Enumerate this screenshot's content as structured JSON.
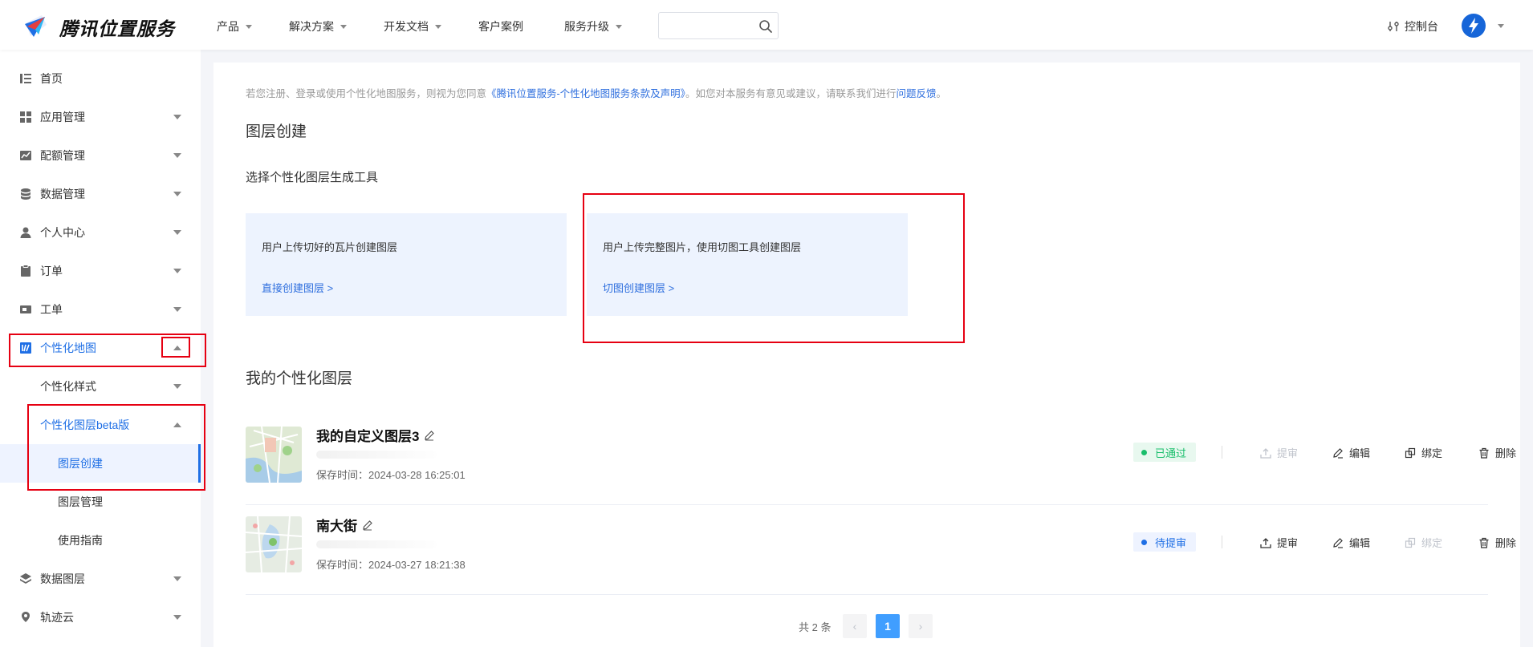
{
  "brand": {
    "name": "腾讯位置服务"
  },
  "topnav": {
    "items": [
      "产品",
      "解决方案",
      "开发文档",
      "客户案例",
      "服务升级"
    ],
    "search_placeholder": "",
    "console_label": "控制台"
  },
  "sidebar": {
    "items": [
      {
        "label": "首页",
        "icon": "list-icon"
      },
      {
        "label": "应用管理",
        "icon": "grid-icon"
      },
      {
        "label": "配额管理",
        "icon": "chart-icon"
      },
      {
        "label": "数据管理",
        "icon": "database-icon"
      },
      {
        "label": "个人中心",
        "icon": "user-icon"
      },
      {
        "label": "订单",
        "icon": "clipboard-icon"
      },
      {
        "label": "工单",
        "icon": "ticket-icon"
      },
      {
        "label": "个性化地图",
        "icon": "custom-map-icon"
      },
      {
        "label": "个性化样式"
      },
      {
        "label": "个性化图层beta版"
      },
      {
        "label": "图层创建"
      },
      {
        "label": "图层管理"
      },
      {
        "label": "使用指南"
      },
      {
        "label": "数据图层",
        "icon": "layers-icon"
      },
      {
        "label": "轨迹云",
        "icon": "location-icon"
      }
    ]
  },
  "main": {
    "notice": {
      "prefix": "若您注册、登录或使用个性化地图服务，则视为您同意",
      "link": "《腾讯位置服务-个性化地图服务条款及声明》",
      "middle": "。如您对本服务有意见或建议，请联系我们进行",
      "feedback": "问题反馈",
      "suffix": "。"
    },
    "section_title": "图层创建",
    "tool_title": "选择个性化图层生成工具",
    "cards": [
      {
        "desc": "用户上传切好的瓦片创建图层",
        "link": "直接创建图层 >"
      },
      {
        "desc": "用户上传完整图片，使用切图工具创建图层",
        "link": "切图创建图层 >"
      }
    ],
    "my_layers_title": "我的个性化图层",
    "layers": [
      {
        "name": "我的自定义图层3",
        "save_time": "保存时间：2024-03-28 16:25:01",
        "status": "已通过",
        "status_color": "#19be6b"
      },
      {
        "name": "南大街",
        "save_time": "保存时间：2024-03-27 18:21:38",
        "status": "待提审",
        "status_color": "#1f6fe5"
      }
    ],
    "ops": {
      "submit": "提审",
      "edit": "编辑",
      "bind": "绑定",
      "delete": "删除"
    },
    "pager": {
      "total": "共 2 条",
      "current": "1",
      "prev": "‹",
      "next": "›"
    }
  },
  "colors": {
    "accent": "#1f6fe5",
    "highlight_box": "#e60012",
    "card_bg": "#edf3fe"
  }
}
